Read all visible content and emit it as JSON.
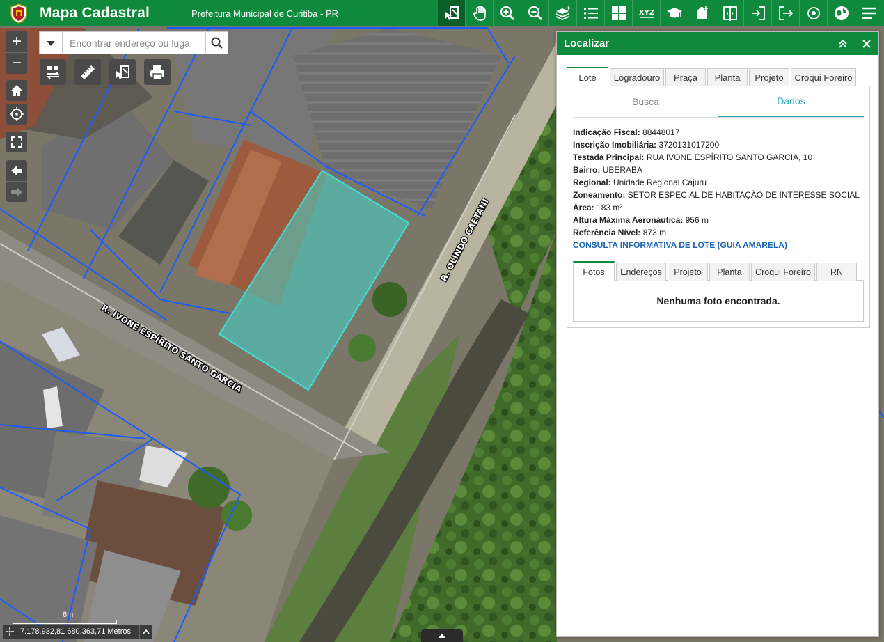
{
  "header": {
    "title": "Mapa Cadastral",
    "subtitle": "Prefeitura Municipal de Curitiba - PR",
    "toolbar_icons": [
      "identify-icon",
      "pan-hand-icon",
      "zoom-in-icon",
      "zoom-out-icon",
      "layers-icon",
      "legend-list-icon",
      "basemap-grid-icon",
      "xyz-coordinates-icon",
      "education-icon",
      "add-data-icon",
      "swipe-compare-icon",
      "login-icon",
      "logout-icon",
      "locate-target-icon",
      "theme-map-icon",
      "menu-icon"
    ],
    "xyz_label": "XYZ"
  },
  "map": {
    "search_placeholder": "Encontrar endereço ou luga",
    "street_1": "R. IVONE ESPÍRITO SANTO GARCIA",
    "street_2": "R. OLINDO CAETANI",
    "scale_label": "6m",
    "coordinates": "7.178.932,81 680.363,71 Metros",
    "zoom_in": "+",
    "zoom_out": "−"
  },
  "panel": {
    "title": "Localizar",
    "tabs": [
      "Lote",
      "Logradouro",
      "Praça",
      "Planta",
      "Projeto",
      "Croqui Foreiro"
    ],
    "active_tab": "Lote",
    "subtabs": [
      "Busca",
      "Dados"
    ],
    "active_subtab": "Dados",
    "fields": [
      {
        "label": "Indicação Fiscal:",
        "value": "88448017"
      },
      {
        "label": "Inscrição Imobiliária:",
        "value": "3720131017200"
      },
      {
        "label": "Testada Principal:",
        "value": "RUA IVONE ESPÍRITO SANTO GARCIA, 10"
      },
      {
        "label": "Bairro:",
        "value": "UBERABA"
      },
      {
        "label": "Regional:",
        "value": "Unidade Regional Cajuru"
      },
      {
        "label": "Zoneamento:",
        "value": "SETOR ESPECIAL DE HABITAÇÃO DE INTERESSE SOCIAL"
      },
      {
        "label": "Área:",
        "value": "183 m²"
      },
      {
        "label": "Altura Máxima Aeronáutica:",
        "value": "956 m"
      },
      {
        "label": "Referência Nível:",
        "value": "873 m"
      }
    ],
    "link": "CONSULTA INFORMATIVA DE LOTE (GUIA AMARELA)",
    "tabs2": [
      "Fotos",
      "Endereços",
      "Projeto",
      "Planta",
      "Croqui Foreiro",
      "RN"
    ],
    "active_tab2": "Fotos",
    "no_photo": "Nenhuma foto encontrada."
  },
  "colors": {
    "brand": "#0f8a3c",
    "selection": "#3ee0d8",
    "lot_lines": "#1a5cff",
    "link": "#1a64b4",
    "active_subtab": "#26a9b5"
  }
}
